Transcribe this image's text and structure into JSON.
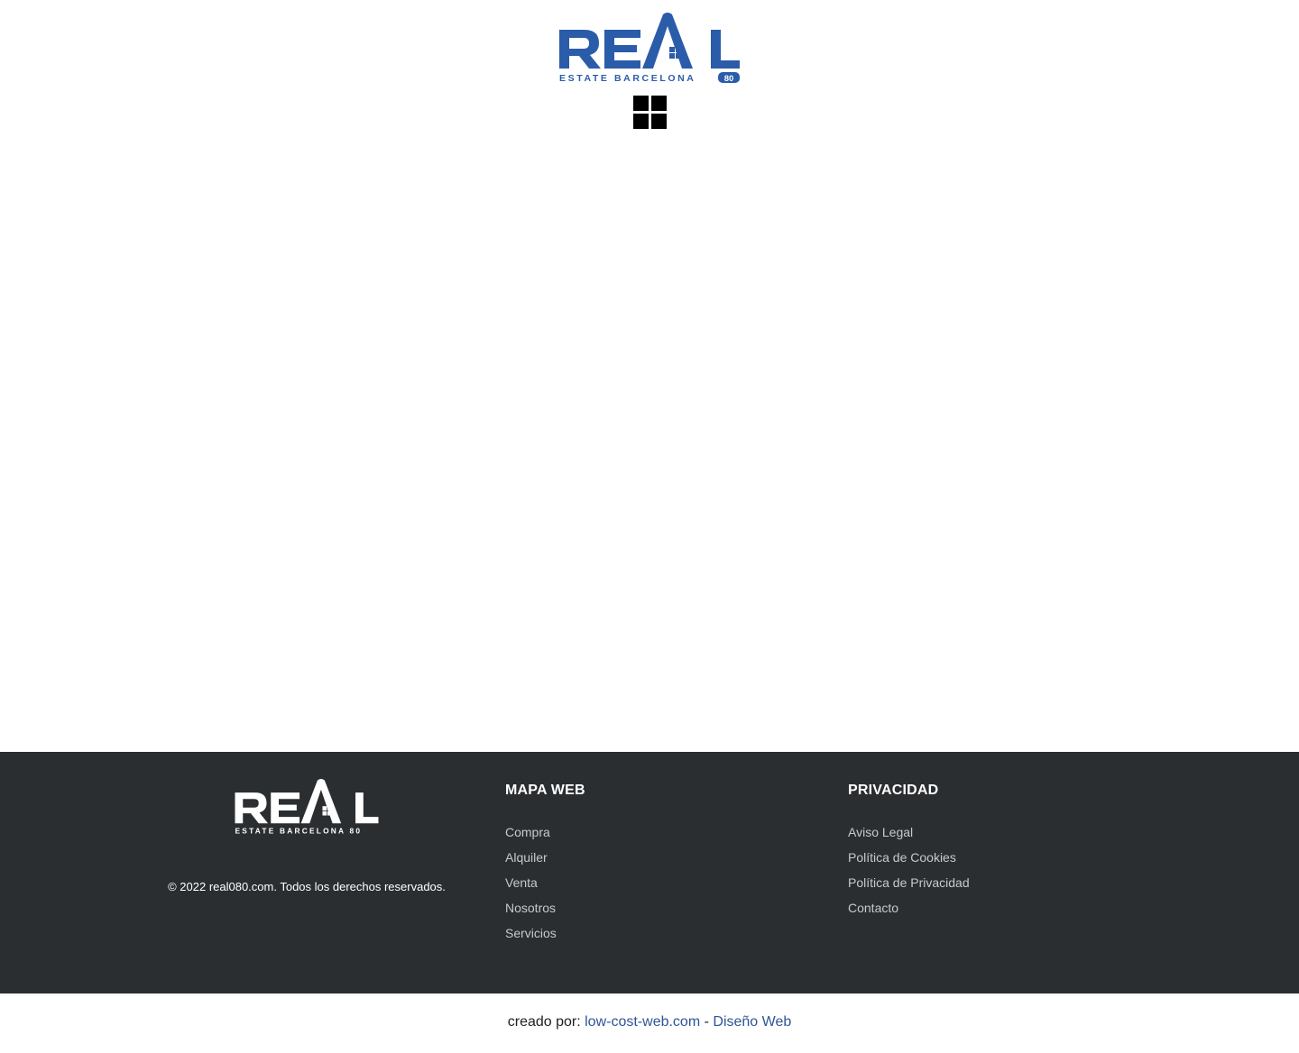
{
  "header": {
    "logo": {
      "word": "REAL",
      "subtitle": "ESTATE BARCELONA",
      "badge": "80",
      "color": "#2a5caa"
    },
    "menu_icon": "grid-menu-icon"
  },
  "footer": {
    "logo": {
      "word": "REAL",
      "subtitle": "ESTATE BARCELONA 80",
      "color": "#ffffff"
    },
    "copyright": "© 2022 real080.com. Todos los derechos reservados.",
    "sitemap": {
      "title": "MAPA WEB",
      "links": [
        "Compra",
        "Alquiler",
        "Venta",
        "Nosotros",
        "Servicios"
      ]
    },
    "privacy": {
      "title": "PRIVACIDAD",
      "links": [
        "Aviso Legal",
        "Política de Cookies",
        "Política de Privacidad",
        "Contacto"
      ]
    },
    "background": "#2b2e31"
  },
  "credits": {
    "prefix": "creado por:",
    "link1": "low-cost-web.com",
    "separator": "-",
    "link2": "Diseño Web",
    "link_color": "#2f5597"
  }
}
